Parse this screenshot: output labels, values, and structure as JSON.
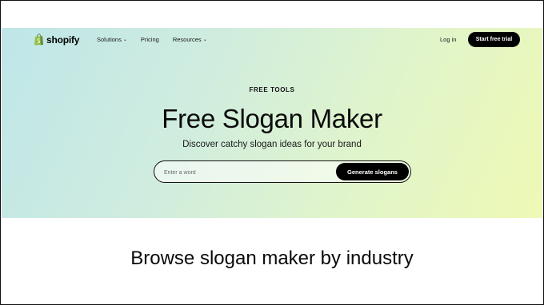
{
  "nav": {
    "logo_text": "shopify",
    "links": [
      {
        "label": "Solutions",
        "dropdown": true
      },
      {
        "label": "Pricing",
        "dropdown": false
      },
      {
        "label": "Resources",
        "dropdown": true
      }
    ],
    "login": "Log in",
    "cta": "Start free trial"
  },
  "hero": {
    "eyebrow": "FREE TOOLS",
    "title": "Free Slogan Maker",
    "subtitle": "Discover catchy slogan ideas for your brand",
    "search_placeholder": "Enter a word",
    "generate_button": "Generate slogans"
  },
  "browse": {
    "heading": "Browse slogan maker by industry"
  },
  "colors": {
    "brand_green": "#95BF47",
    "button_black": "#000000",
    "hero_gradient_start": "#bfe6e9",
    "hero_gradient_end": "#eef9b4"
  },
  "icons": [
    "shopify-bag-icon",
    "chevron-down-icon"
  ]
}
